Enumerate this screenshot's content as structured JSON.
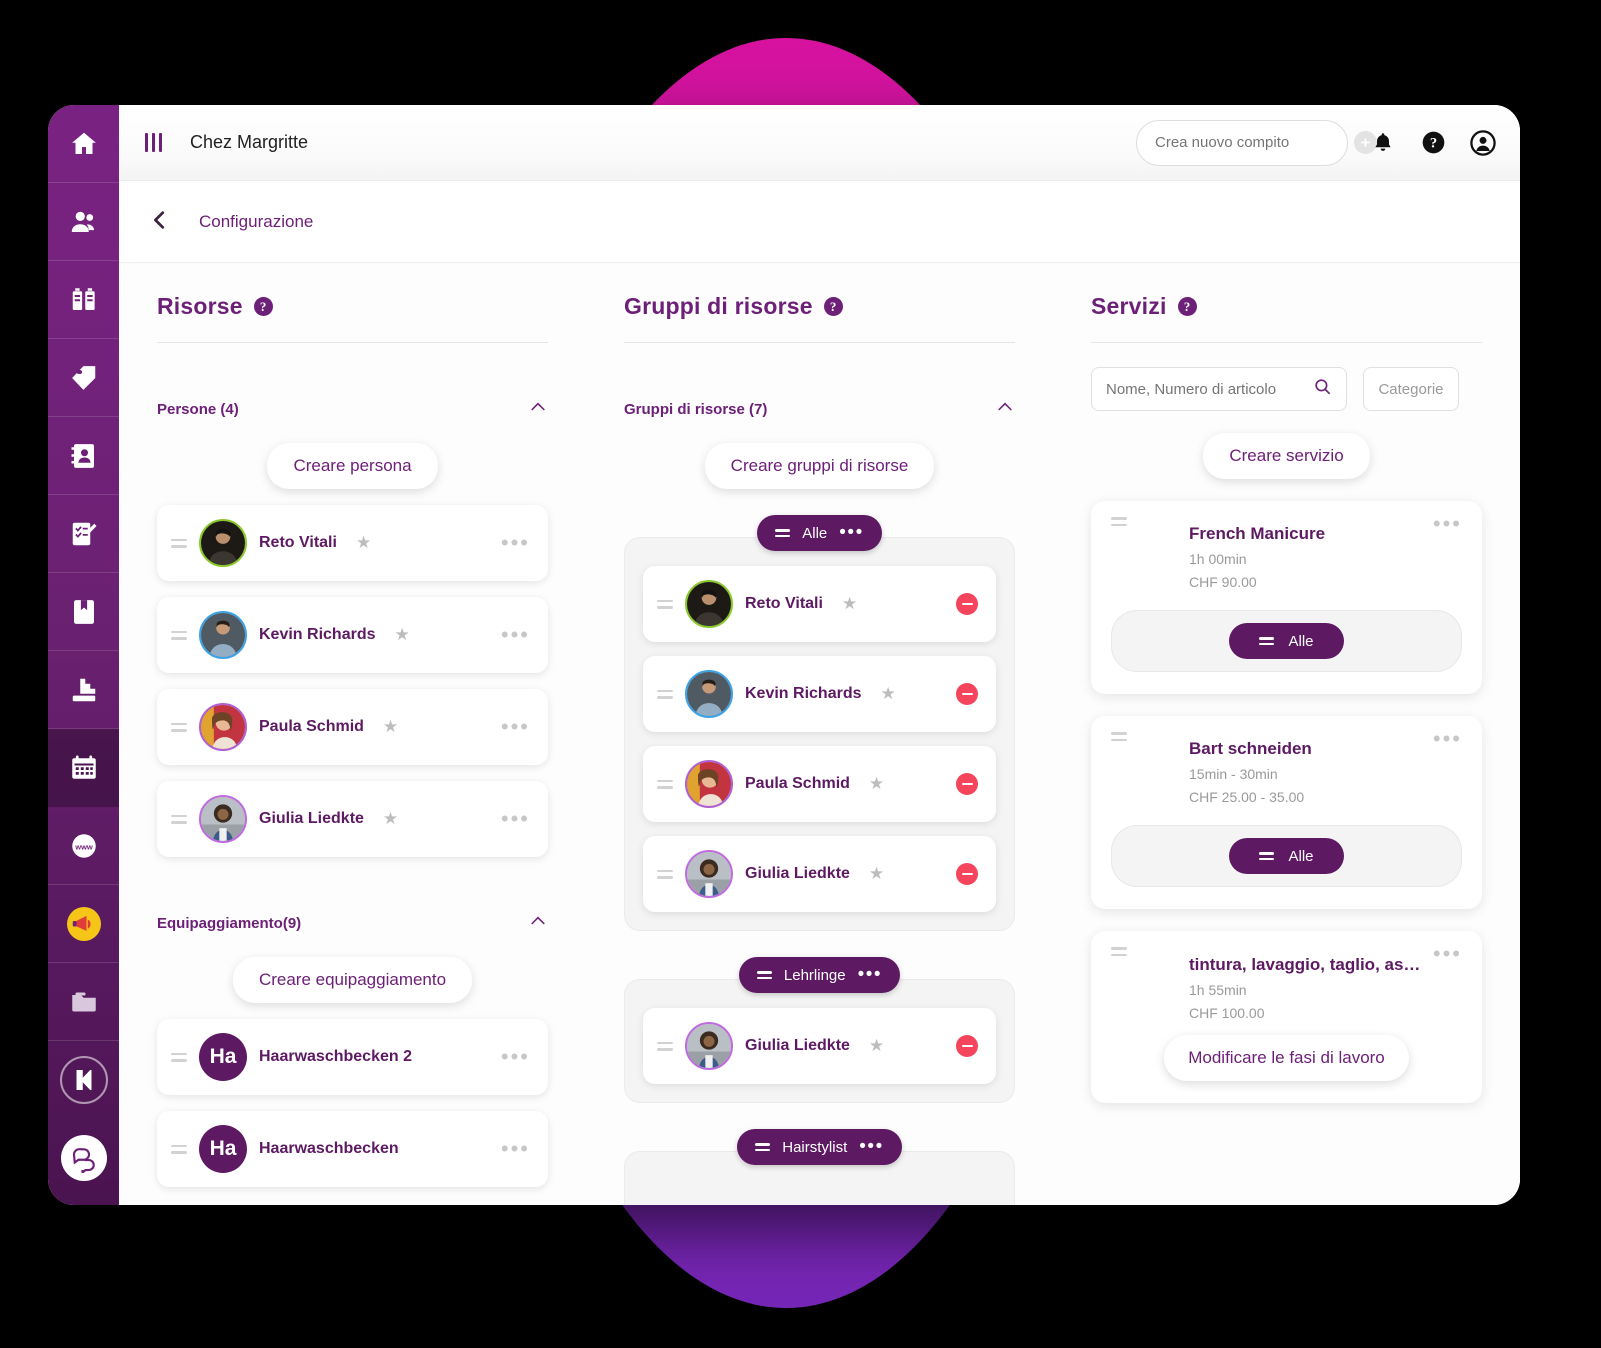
{
  "theme": {
    "brand_purple": "#6d2077",
    "deep_purple": "#5d1a63",
    "magenta": "#d6129f",
    "danger_red": "#f4455c"
  },
  "topbar": {
    "menu_icon": "hamburger-icon",
    "brand": "Chez Margritte",
    "task_placeholder": "Crea nuovo compito",
    "icons": [
      "bell-icon",
      "help-icon",
      "account-icon"
    ]
  },
  "breadcrumb": {
    "back_icon": "chevron-left-icon",
    "label": "Configurazione"
  },
  "sidebar": {
    "items": [
      {
        "icon": "home-icon",
        "active": false
      },
      {
        "icon": "people-icon",
        "active": false
      },
      {
        "icon": "building-icon",
        "active": false
      },
      {
        "icon": "tag-icon",
        "active": false
      },
      {
        "icon": "contacts-icon",
        "active": false
      },
      {
        "icon": "checklist-icon",
        "active": false
      },
      {
        "icon": "book-icon",
        "active": false
      },
      {
        "icon": "stairs-icon",
        "active": false
      },
      {
        "icon": "calendar-icon",
        "active": true
      },
      {
        "icon": "www-globe-icon",
        "active": false
      },
      {
        "icon": "megaphone-badge-icon",
        "active": false
      },
      {
        "icon": "folder-icon",
        "active": false
      },
      {
        "icon": "k-logo-icon",
        "active": false
      },
      {
        "icon": "chat-icon",
        "active": false
      }
    ]
  },
  "columns": {
    "resources": {
      "title": "Risorse",
      "help_icon": "question-icon",
      "sections": [
        {
          "header": "Persone (4)",
          "collapse_icon": "chevron-up-icon",
          "create_label": "Creare persona",
          "items": [
            {
              "name": "Reto Vitali",
              "avatar_type": "photo",
              "ring": "#8ac92a",
              "photo": "#2a2521",
              "starred": false,
              "menu_icon": "ellipsis-icon"
            },
            {
              "name": "Kevin Richards",
              "avatar_type": "photo",
              "ring": "#3ba3e8",
              "photo": "#56646d",
              "starred": false,
              "menu_icon": "ellipsis-icon"
            },
            {
              "name": "Paula Schmid",
              "avatar_type": "photo",
              "ring": "#b05fd4",
              "photo": "#c8414a",
              "starred": false,
              "menu_icon": "ellipsis-icon"
            },
            {
              "name": "Giulia Liedkte",
              "avatar_type": "photo",
              "ring": "#c06ae0",
              "photo": "#9aa3ad",
              "starred": false,
              "menu_icon": "ellipsis-icon"
            }
          ]
        },
        {
          "header": "Equipaggiamento(9)",
          "collapse_icon": "chevron-up-icon",
          "create_label": "Creare equipaggiamento",
          "items": [
            {
              "name": "Haarwaschbecken 2",
              "avatar_type": "initials",
              "initials": "Ha",
              "starred": false,
              "menu_icon": "ellipsis-icon"
            },
            {
              "name": "Haarwaschbecken",
              "avatar_type": "initials",
              "initials": "Ha",
              "starred": false,
              "menu_icon": "ellipsis-icon"
            }
          ]
        }
      ]
    },
    "resource_groups": {
      "title": "Gruppi di risorse",
      "help_icon": "question-icon",
      "section_header": "Gruppi di risorse (7)",
      "collapse_icon": "chevron-up-icon",
      "create_label": "Creare gruppi di risorse",
      "groups": [
        {
          "label": "Alle",
          "drag_icon": "drag-handle-icon",
          "menu_icon": "ellipsis-icon",
          "members": [
            {
              "name": "Reto Vitali",
              "ring": "#8ac92a",
              "photo": "#2a2521",
              "remove_icon": "remove-icon"
            },
            {
              "name": "Kevin Richards",
              "ring": "#3ba3e8",
              "photo": "#56646d",
              "remove_icon": "remove-icon"
            },
            {
              "name": "Paula Schmid",
              "ring": "#b05fd4",
              "photo": "#c8414a",
              "remove_icon": "remove-icon"
            },
            {
              "name": "Giulia Liedkte",
              "ring": "#c06ae0",
              "photo": "#9aa3ad",
              "remove_icon": "remove-icon"
            }
          ]
        },
        {
          "label": "Lehrlinge",
          "drag_icon": "drag-handle-icon",
          "menu_icon": "ellipsis-icon",
          "members": [
            {
              "name": "Giulia Liedkte",
              "ring": "#c06ae0",
              "photo": "#9aa3ad",
              "remove_icon": "remove-icon"
            }
          ]
        },
        {
          "label": "Hairstylist",
          "drag_icon": "drag-handle-icon",
          "menu_icon": "ellipsis-icon",
          "members": []
        }
      ]
    },
    "services": {
      "title": "Servizi",
      "help_icon": "question-icon",
      "search_placeholder": "Nome, Numero di articolo",
      "search_icon": "search-icon",
      "categories_label": "Categorie",
      "create_label": "Creare servizio",
      "cards": [
        {
          "name": "French Manicure",
          "duration": "1h 00min",
          "price": "CHF 90.00",
          "drag_icon": "drag-handle-icon",
          "menu_icon": "ellipsis-icon",
          "group_chip": "Alle",
          "action": null
        },
        {
          "name": "Bart schneiden",
          "duration": "15min - 30min",
          "price": "CHF 25.00 - 35.00",
          "drag_icon": "drag-handle-icon",
          "menu_icon": "ellipsis-icon",
          "group_chip": "Alle",
          "action": null
        },
        {
          "name": "tintura, lavaggio, taglio, as…",
          "duration": "1h 55min",
          "price": "CHF 100.00",
          "drag_icon": "drag-handle-icon",
          "menu_icon": "ellipsis-icon",
          "group_chip": null,
          "action": "Modificare le fasi di lavoro"
        }
      ]
    }
  }
}
